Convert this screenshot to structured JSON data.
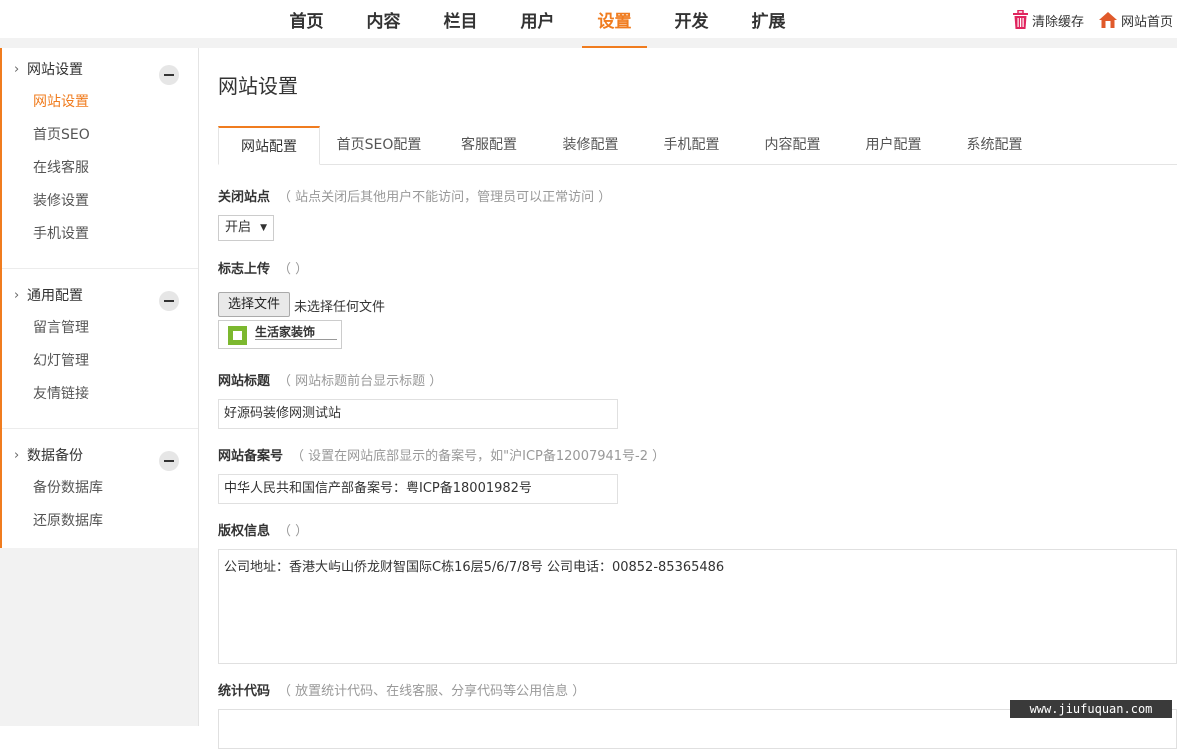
{
  "nav": {
    "items": [
      "首页",
      "内容",
      "栏目",
      "用户",
      "设置",
      "开发",
      "扩展"
    ],
    "active_index": 4
  },
  "top_actions": {
    "clear_cache": "清除缓存",
    "site_home": "网站首页"
  },
  "sidebar": {
    "groups": [
      {
        "title": "网站设置",
        "items": [
          "网站设置",
          "首页SEO",
          "在线客服",
          "装修设置",
          "手机设置"
        ],
        "active_item": 0
      },
      {
        "title": "通用配置",
        "items": [
          "留言管理",
          "幻灯管理",
          "友情链接"
        ]
      },
      {
        "title": "数据备份",
        "items": [
          "备份数据库",
          "还原数据库"
        ]
      }
    ]
  },
  "main": {
    "title": "网站设置",
    "tabs": [
      "网站配置",
      "首页SEO配置",
      "客服配置",
      "装修配置",
      "手机配置",
      "内容配置",
      "用户配置",
      "系统配置"
    ],
    "active_tab": 0,
    "fields": {
      "close_site": {
        "label": "关闭站点",
        "hint": "（ 站点关闭后其他用户不能访问，管理员可以正常访问 ）",
        "value": "开启"
      },
      "logo_upload": {
        "label": "标志上传",
        "hint": "（ ）",
        "button": "选择文件",
        "status": "未选择任何文件",
        "logo_text": "生活家装饰"
      },
      "site_title": {
        "label": "网站标题",
        "hint": "（ 网站标题前台显示标题 ）",
        "value": "好源码装修网测试站"
      },
      "icp": {
        "label": "网站备案号",
        "hint": "（ 设置在网站底部显示的备案号，如\"沪ICP备12007941号-2 ）",
        "value": "中华人民共和国信产部备案号：粤ICP备18001982号"
      },
      "copyright": {
        "label": "版权信息",
        "hint": "（ ）",
        "value": "公司地址：香港大屿山侨龙财智国际C栋16层5/6/7/8号 公司电话：00852-85365486"
      },
      "stats_code": {
        "label": "统计代码",
        "hint": "（ 放置统计代码、在线客服、分享代码等公用信息 ）"
      }
    }
  },
  "watermark": "www.jiufuquan.com",
  "colors": {
    "accent": "#f07c1f",
    "logo_green": "#7cb82f"
  }
}
